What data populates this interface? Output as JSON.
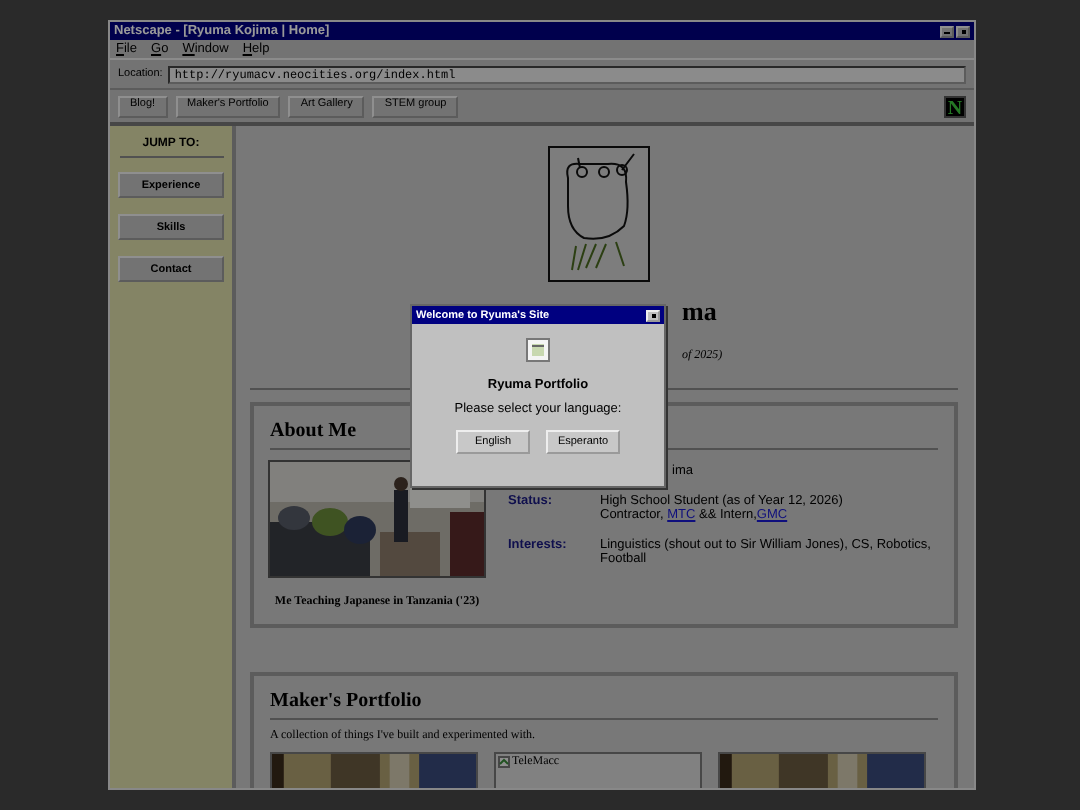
{
  "window": {
    "title": "Netscape - [Ryuma Kojima | Home]"
  },
  "menu": [
    "File",
    "Go",
    "Window",
    "Help"
  ],
  "location": {
    "label": "Location:",
    "value": "http://ryumacv.neocities.org/index.html"
  },
  "nav_buttons": [
    "Blog!",
    "Maker's Portfolio",
    "Art Gallery",
    "STEM group"
  ],
  "logo": "N",
  "sidebar": {
    "heading": "JUMP TO:",
    "items": [
      "Experience",
      "Skills",
      "Contact"
    ]
  },
  "header": {
    "name_fragment": "ma",
    "subtitle_fragment": "of 2025)"
  },
  "about": {
    "title": "About Me",
    "photo_caption": "Me Teaching Japanese in Tanzania ('23)",
    "name_fragment": "ima",
    "rows": [
      {
        "label": "Status:",
        "lines": [
          [
            {
              "text": "High School Student (as of Year 12, 2026)",
              "link": false
            }
          ],
          [
            {
              "text": "Contractor, ",
              "link": false
            },
            {
              "text": "MTC",
              "link": true
            },
            {
              "text": " && Intern,",
              "link": false
            },
            {
              "text": "GMC",
              "link": true
            }
          ]
        ]
      },
      {
        "label": "Interests:",
        "lines": [
          [
            {
              "text": "Linguistics (shout out to Sir William Jones), CS, Robotics, Football",
              "link": false
            }
          ]
        ]
      }
    ]
  },
  "portfolio": {
    "title": "Maker's Portfolio",
    "intro": "A collection of things I've built and experimented with.",
    "cards": [
      {
        "kind": "picture"
      },
      {
        "kind": "broken",
        "alt": "TeleMacc"
      },
      {
        "kind": "picture"
      }
    ]
  },
  "dialog": {
    "title": "Welcome to Ryuma's Site",
    "heading": "Ryuma Portfolio",
    "prompt": "Please select your language:",
    "buttons": [
      "English",
      "Esperanto"
    ]
  }
}
